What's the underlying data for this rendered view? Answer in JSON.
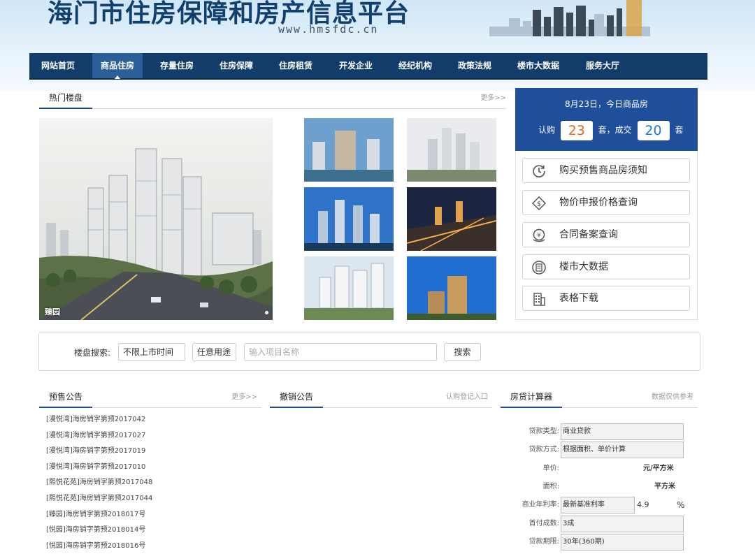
{
  "header": {
    "site_title": "海门市住房保障和房产信息平台",
    "site_url": "www.hmsfdc.cn"
  },
  "nav": {
    "items": [
      "网站首页",
      "商品住房",
      "存量住房",
      "住房保障",
      "住房租赁",
      "开发企业",
      "经纪机构",
      "政策法规",
      "楼市大数据",
      "服务大厅"
    ],
    "active_index": 1
  },
  "hot_listings": {
    "title": "热门楼盘",
    "more": "更多>>",
    "featured_caption": "臻园"
  },
  "stats": {
    "date_line": "8月23日，今日商品房",
    "subscribe_label": "认购",
    "subscribe_count": "23",
    "unit_mid": "套，成交",
    "deal_count": "20",
    "unit_end": "套",
    "subscribe_color": "#e26a1c",
    "deal_color": "#1f7ad6"
  },
  "quick_links": [
    {
      "label": "购买预售商品房须知",
      "icon": "clock-refresh-icon"
    },
    {
      "label": "物价申报价格查询",
      "icon": "price-tag-icon"
    },
    {
      "label": "合同备案查询",
      "icon": "yuan-coin-icon"
    },
    {
      "label": "楼市大数据",
      "icon": "document-icon"
    },
    {
      "label": "表格下载",
      "icon": "building-icon"
    }
  ],
  "search": {
    "label": "楼盘搜索:",
    "time_filter": "不限上市时间",
    "usage_filter": "任意用途",
    "input_placeholder": "输入项目名称",
    "button": "搜索"
  },
  "presale": {
    "title": "预售公告",
    "more": "更多>>",
    "items": [
      "[漫悦湾]海房销字第预2017042",
      "[漫悦湾]海房销字第预2017027",
      "[漫悦湾]海房销字第预2017019",
      "[漫悦湾]海房销字第预2017010",
      "[熙悦花苑]海房销字第预2017048",
      "[熙悦花苑]海房销字第预2017044",
      "[臻园]海房销字第预2018017号",
      "[悦园]海房销字第预2018014号",
      "[悦园]海房销字第预2018016号"
    ]
  },
  "revoke": {
    "title": "撤销公告",
    "more": "认购登记入口"
  },
  "calculator": {
    "title": "房贷计算器",
    "note": "数据仅供参考",
    "loan_type_label": "贷款类型:",
    "loan_type_value": "商业贷款",
    "method_label": "贷款方式:",
    "method_value": "根据面积、单价计算",
    "price_label": "单价:",
    "price_unit": "元/平方米",
    "area_label": "面积:",
    "area_unit": "平方米",
    "rate_label": "商业年利率:",
    "rate_select": "最新基准利率",
    "rate_value": "4.9",
    "rate_unit": "%",
    "down_label": "首付成数:",
    "down_value": "3成",
    "term_label": "贷款期限:",
    "term_value": "30年(360期)"
  }
}
